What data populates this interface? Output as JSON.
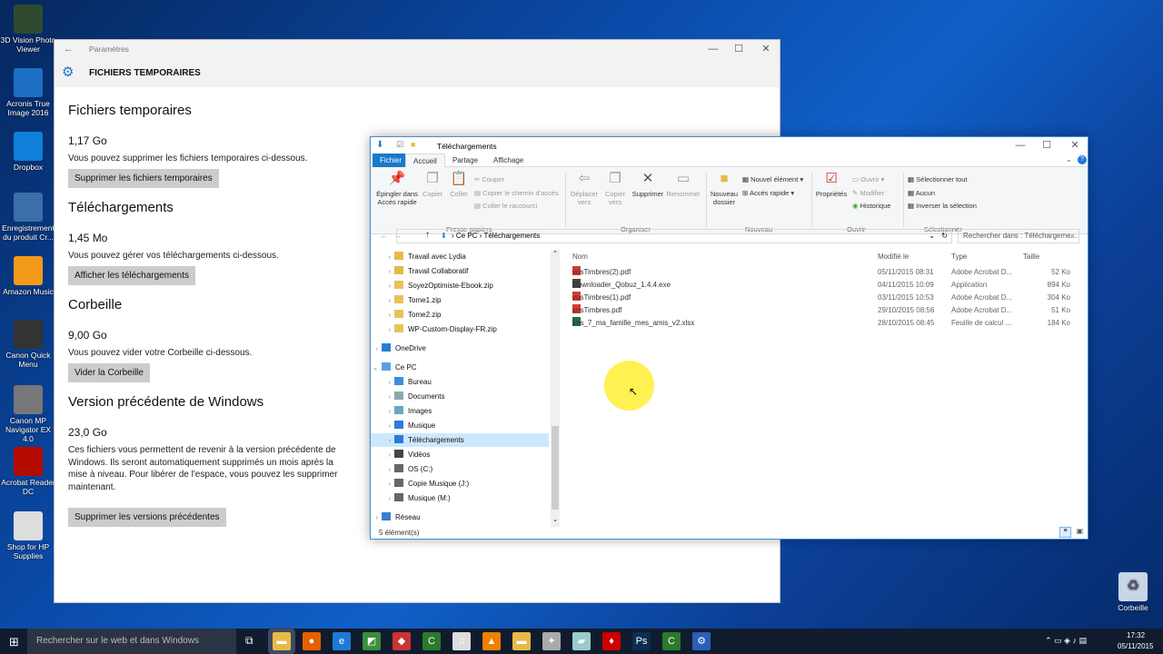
{
  "desktop": {
    "icons": [
      {
        "label": "3D Vision Photo Viewer",
        "icon": "3d-vision-icon",
        "color": "#2f4a2f"
      },
      {
        "label": "Acronis True Image 2016",
        "icon": "acronis-icon",
        "color": "#1d6fc4"
      },
      {
        "label": "Dropbox",
        "icon": "dropbox-icon",
        "color": "#0f7fd9"
      },
      {
        "label": "Enregistrement du produit Cr...",
        "icon": "registration-icon",
        "color": "#3b6fa9"
      },
      {
        "label": "Amazon Music",
        "icon": "amazon-music-icon",
        "color": "#f49a1a"
      },
      {
        "label": "Canon Quick Menu",
        "icon": "canon-quick-menu-icon",
        "color": "#333"
      },
      {
        "label": "Canon MP Navigator EX 4.0",
        "icon": "canon-navigator-icon",
        "color": "#777"
      },
      {
        "label": "Acrobat Reader DC",
        "icon": "acrobat-icon",
        "color": "#b30b00"
      },
      {
        "label": "Shop for HP Supplies",
        "icon": "hp-shop-icon",
        "color": "#ddd"
      }
    ],
    "recycle": "Corbeille"
  },
  "settings": {
    "app_title": "Paramètres",
    "page_title": "FICHIERS TEMPORAIRES",
    "sections": [
      {
        "title": "Fichiers temporaires",
        "size": "1,17 Go",
        "desc": "Vous pouvez supprimer les fichiers temporaires ci-dessous.",
        "button": "Supprimer les fichiers temporaires"
      },
      {
        "title": "Téléchargements",
        "size": "1,45 Mo",
        "desc": "Vous pouvez gérer vos téléchargements ci-dessous.",
        "button": "Afficher les téléchargements"
      },
      {
        "title": "Corbeille",
        "size": "9,00 Go",
        "desc": "Vous pouvez vider votre Corbeille ci-dessous.",
        "button": "Vider la Corbeille"
      },
      {
        "title": "Version précédente de Windows",
        "size": "23,0 Go",
        "desc": "Ces fichiers vous permettent de revenir à la version précédente de Windows. Ils seront automatiquement supprimés un mois après la mise à niveau. Pour libérer de l'espace, vous pouvez les supprimer maintenant.",
        "button": "Supprimer les versions précédentes"
      }
    ]
  },
  "explorer": {
    "title": "Téléchargements",
    "tabs": [
      "Fichier",
      "Accueil",
      "Partage",
      "Affichage"
    ],
    "ribbon": {
      "pin": "Épingler dans Accès rapide",
      "copy": "Copier",
      "paste": "Coller",
      "cut": "Couper",
      "copy_path": "Copier le chemin d'accès",
      "paste_shortcut": "Coller le raccourci",
      "move": "Déplacer vers",
      "copy_to": "Copier vers",
      "delete": "Supprimer",
      "rename": "Renommer",
      "new_folder": "Nouveau dossier",
      "new_item": "Nouvel élément",
      "quick_access": "Accès rapide",
      "properties": "Propriétés",
      "open": "Ouvrir",
      "edit": "Modifier",
      "history": "Historique",
      "select_all": "Sélectionner tout",
      "select_none": "Aucun",
      "invert": "Inverser la sélection",
      "groups": [
        "Presse-papiers",
        "Organiser",
        "Nouveau",
        "Ouvrir",
        "Sélectionner"
      ]
    },
    "address": {
      "root": "Ce PC",
      "folder": "Téléchargements"
    },
    "search_placeholder": "Rechercher dans : Téléchargeme...",
    "nav": [
      {
        "label": "Travail avec Lydia",
        "type": "folder"
      },
      {
        "label": "Travail Collaboratif",
        "type": "folder"
      },
      {
        "label": "SoyezOptimiste-Ebook.zip",
        "type": "zip"
      },
      {
        "label": "Tome1.zip",
        "type": "zip"
      },
      {
        "label": "Tome2.zip",
        "type": "zip"
      },
      {
        "label": "WP-Custom-Display-FR.zip",
        "type": "zip"
      },
      {
        "label": "OneDrive",
        "type": "cloud"
      },
      {
        "label": "Ce PC",
        "type": "pc"
      },
      {
        "label": "Bureau",
        "type": "desktop"
      },
      {
        "label": "Documents",
        "type": "docs"
      },
      {
        "label": "Images",
        "type": "images"
      },
      {
        "label": "Musique",
        "type": "music"
      },
      {
        "label": "Téléchargements",
        "type": "download"
      },
      {
        "label": "Vidéos",
        "type": "video"
      },
      {
        "label": "OS (C:)",
        "type": "drive"
      },
      {
        "label": "Copie Musique (J:)",
        "type": "drive"
      },
      {
        "label": "Musique (M:)",
        "type": "drive"
      },
      {
        "label": "Réseau",
        "type": "network"
      }
    ],
    "columns": [
      "Nom",
      "Modifié le",
      "Type",
      "Taille"
    ],
    "files": [
      {
        "name": "vosTimbres(2).pdf",
        "date": "05/11/2015 08:31",
        "type": "Adobe Acrobat D...",
        "size": "52 Ko",
        "icon": "pdf"
      },
      {
        "name": "Downloader_Qobuz_1.4.4.exe",
        "date": "04/11/2015 10:09",
        "type": "Application",
        "size": "894 Ko",
        "icon": "exe"
      },
      {
        "name": "vosTimbres(1).pdf",
        "date": "03/11/2015 10:53",
        "type": "Adobe Acrobat D...",
        "size": "304 Ko",
        "icon": "pdf"
      },
      {
        "name": "vosTimbres.pdf",
        "date": "29/10/2015 08:56",
        "type": "Adobe Acrobat D...",
        "size": "51 Ko",
        "icon": "pdf"
      },
      {
        "name": "lms_7_ma_famille_mes_amis_v2.xlsx",
        "date": "28/10/2015 08:45",
        "type": "Feuille de calcul ...",
        "size": "184 Ko",
        "icon": "xlsx"
      }
    ],
    "status": "5 élément(s)"
  },
  "taskbar": {
    "search": "Rechercher sur le web et dans Windows",
    "time": "17:32",
    "date": "05/11/2015"
  }
}
